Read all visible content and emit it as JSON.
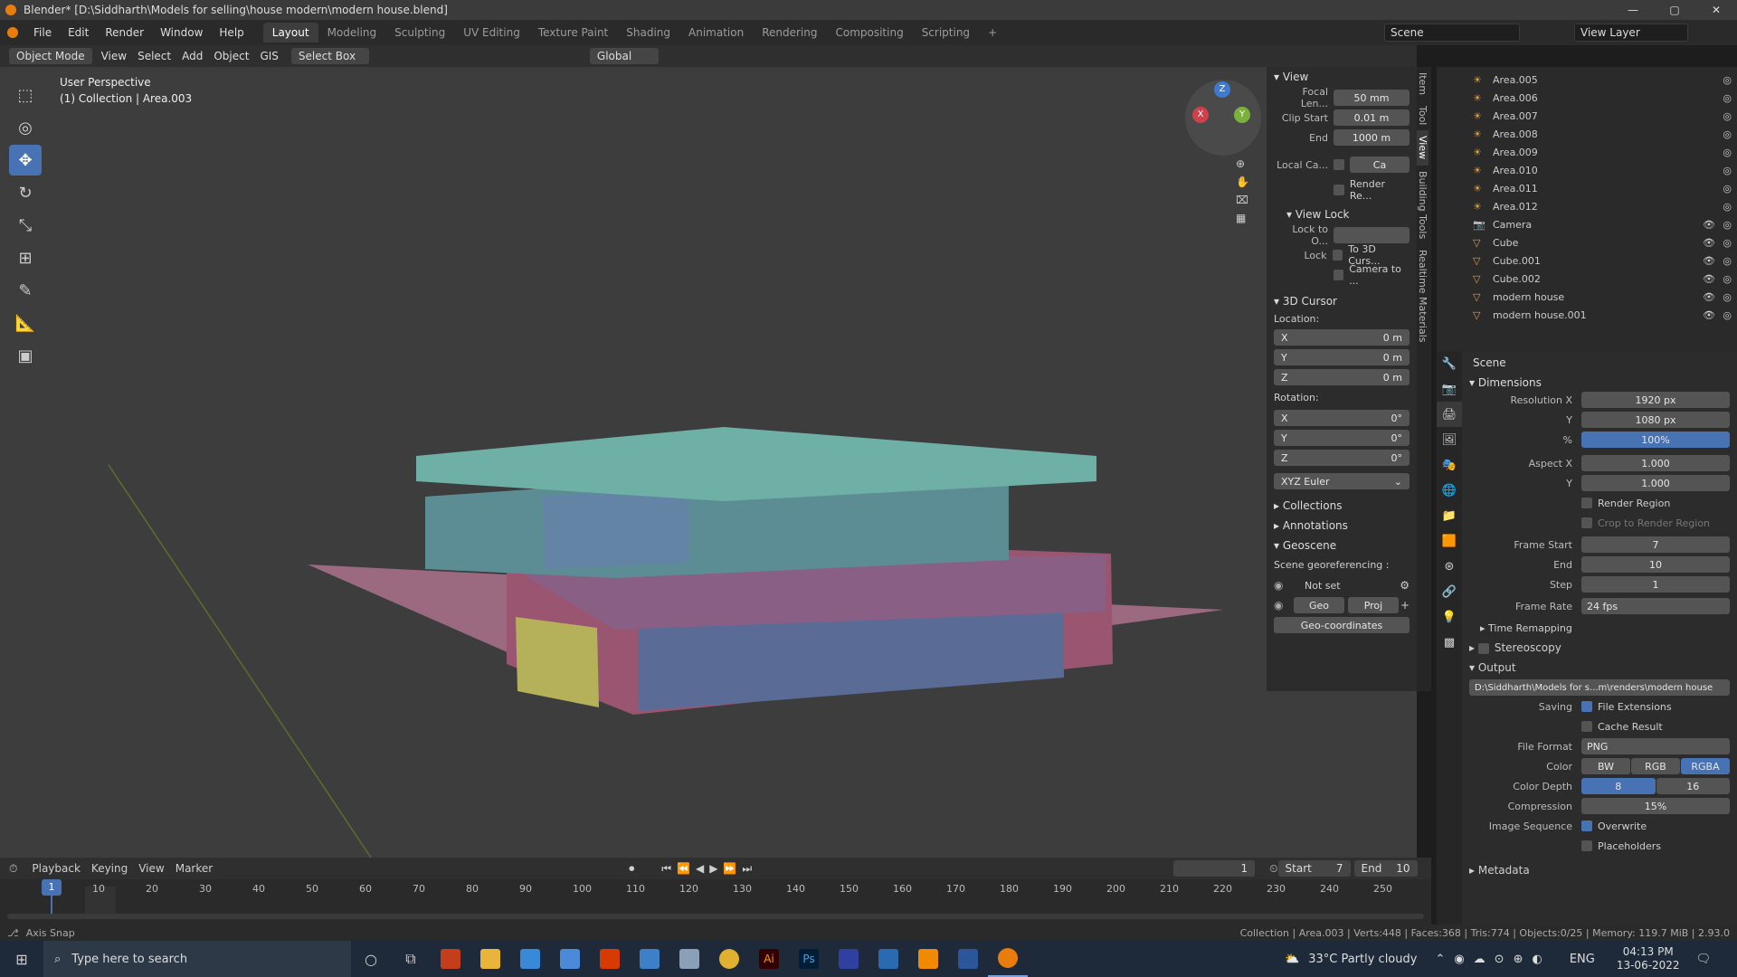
{
  "window": {
    "title": "Blender* [D:\\Siddharth\\Models for selling\\house modern\\modern house.blend]",
    "min": "—",
    "max": "▢",
    "close": "✕"
  },
  "menu": [
    "File",
    "Edit",
    "Render",
    "Window",
    "Help"
  ],
  "workspaces": [
    "Layout",
    "Modeling",
    "Sculpting",
    "UV Editing",
    "Texture Paint",
    "Shading",
    "Animation",
    "Rendering",
    "Compositing",
    "Scripting"
  ],
  "scene": {
    "scene_name": "Scene",
    "view_layer": "View Layer"
  },
  "header3d": {
    "mode": "Object Mode",
    "view": "View",
    "select": "Select",
    "add": "Add",
    "object": "Object",
    "gis": "GIS",
    "select_box": "Select Box",
    "orientation": "Global"
  },
  "viewport": {
    "perspective": "User Perspective",
    "collection": "(1) Collection | Area.003",
    "axis_x": "X",
    "axis_y": "Y",
    "axis_z": "Z"
  },
  "npanel": {
    "view_title": "View",
    "focal_label": "Focal Len...",
    "focal_value": "50 mm",
    "clip_start_label": "Clip Start",
    "clip_start_value": "0.01 m",
    "end_label": "End",
    "end_value": "1000 m",
    "local_camera_label": "Local Ca...",
    "local_camera_value": "Ca",
    "render_region": "Render Re...",
    "view_lock_title": "View Lock",
    "lock_to_label": "Lock to O...",
    "lock_label": "Lock",
    "lock_3d_cursor": "To 3D Curs...",
    "camera_to": "Camera to ...",
    "cursor_title": "3D Cursor",
    "location_label": "Location:",
    "loc_x": "0 m",
    "loc_y": "0 m",
    "loc_z": "0 m",
    "rotation_label": "Rotation:",
    "rot_x": "0°",
    "rot_y": "0°",
    "rot_z": "0°",
    "x": "X",
    "y": "Y",
    "z": "Z",
    "euler": "XYZ Euler",
    "collections": "Collections",
    "annotations": "Annotations",
    "geoscene": "Geoscene",
    "georef_label": "Scene georeferencing :",
    "not_set": "Not set",
    "geo": "Geo",
    "proj": "Proj",
    "geo_coords": "Geo-coordinates"
  },
  "vtabs": [
    "Item",
    "Tool",
    "View",
    "Building Tools",
    "Realtime Materials"
  ],
  "outliner": {
    "items": [
      {
        "name": "Area.005",
        "type": "light"
      },
      {
        "name": "Area.006",
        "type": "light"
      },
      {
        "name": "Area.007",
        "type": "light"
      },
      {
        "name": "Area.008",
        "type": "light"
      },
      {
        "name": "Area.009",
        "type": "light"
      },
      {
        "name": "Area.010",
        "type": "light"
      },
      {
        "name": "Area.011",
        "type": "light"
      },
      {
        "name": "Area.012",
        "type": "light"
      },
      {
        "name": "Camera",
        "type": "camera"
      },
      {
        "name": "Cube",
        "type": "mesh"
      },
      {
        "name": "Cube.001",
        "type": "mesh"
      },
      {
        "name": "Cube.002",
        "type": "mesh"
      },
      {
        "name": "modern house",
        "type": "mesh"
      },
      {
        "name": "modern house.001",
        "type": "mesh"
      }
    ]
  },
  "props": {
    "scene": "Scene",
    "dimensions": "Dimensions",
    "res_x_label": "Resolution X",
    "res_x": "1920 px",
    "res_y_label": "Y",
    "res_y": "1080 px",
    "pct_label": "%",
    "pct": "100%",
    "aspect_x_label": "Aspect X",
    "aspect_x": "1.000",
    "aspect_y_label": "Y",
    "aspect_y": "1.000",
    "render_region": "Render Region",
    "crop_region": "Crop to Render Region",
    "frame_start_label": "Frame Start",
    "frame_start": "7",
    "end_label": "End",
    "end": "10",
    "step_label": "Step",
    "step": "1",
    "frame_rate_label": "Frame Rate",
    "frame_rate": "24 fps",
    "time_remapping": "Time Remapping",
    "stereoscopy": "Stereoscopy",
    "output": "Output",
    "output_path": "D:\\Siddharth\\Models for s...m\\renders\\modern house",
    "saving_label": "Saving",
    "file_ext": "File Extensions",
    "cache_result": "Cache Result",
    "file_format_label": "File Format",
    "file_format": "PNG",
    "color_label": "Color",
    "color_bw": "BW",
    "color_rgb": "RGB",
    "color_rgba": "RGBA",
    "depth_label": "Color Depth",
    "depth_8": "8",
    "depth_16": "16",
    "compression_label": "Compression",
    "compression": "15%",
    "image_seq_label": "Image Sequence",
    "overwrite": "Overwrite",
    "placeholders": "Placeholders",
    "metadata": "Metadata"
  },
  "timeline": {
    "playback": "Playback",
    "keying": "Keying",
    "view": "View",
    "marker": "Marker",
    "current_frame": "1",
    "start_label": "Start",
    "start": "7",
    "end_label": "End",
    "end": "10",
    "ticks": [
      "10",
      "20",
      "30",
      "40",
      "50",
      "60",
      "70",
      "80",
      "90",
      "100",
      "110",
      "120",
      "130",
      "140",
      "150",
      "160",
      "170",
      "180",
      "190",
      "200",
      "210",
      "220",
      "230",
      "240",
      "250"
    ],
    "cursor": "1"
  },
  "status": {
    "left": "Axis Snap",
    "right": "Collection | Area.003 | Verts:448 | Faces:368 | Tris:774 | Objects:0/25 | Memory: 119.7 MiB | 2.93.0"
  },
  "taskbar": {
    "search": "Type here to search",
    "weather": "33°C  Partly cloudy",
    "lang": "ENG",
    "time": "04:13 PM",
    "date": "13-06-2022"
  }
}
